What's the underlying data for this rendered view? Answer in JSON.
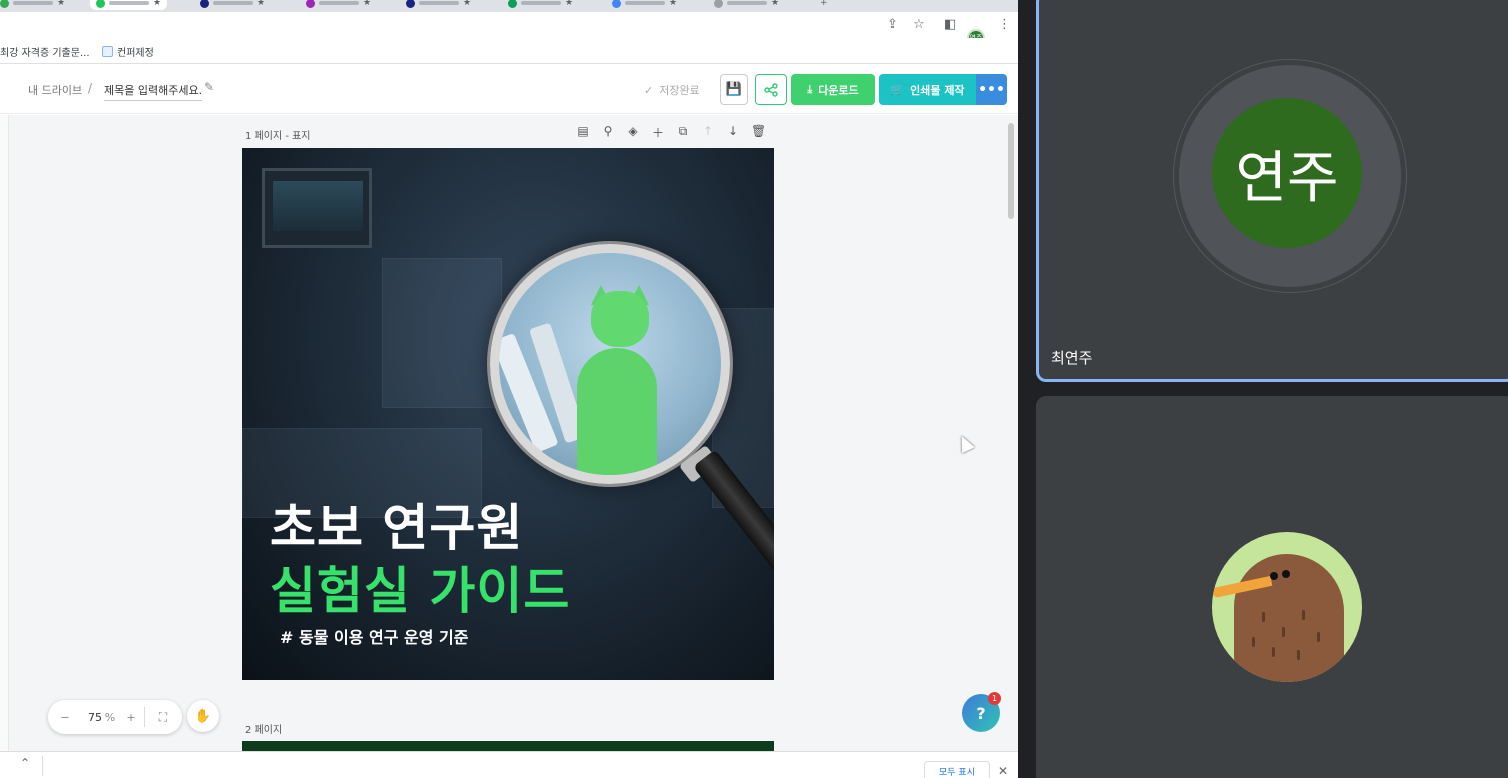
{
  "browser": {
    "tab_count": 8,
    "bookmarks": [
      {
        "label": "최강 자격증 기출문..."
      },
      {
        "label": "컨퍼제정"
      }
    ],
    "profile_initials": "연주"
  },
  "app": {
    "breadcrumb_root": "내 드라이브",
    "breadcrumb_sep": "/",
    "title_placeholder": "제목을 입력해주세요.",
    "save_status": "저장완료",
    "download_label": "다운로드",
    "print_label": "인쇄물 제작"
  },
  "editor": {
    "page1_label": "1 페이지 - 표지",
    "page2_label": "2 페이지",
    "cover": {
      "title_line1": "초보 연구원",
      "title_line2": "실험실 가이드",
      "subtitle": "# 동물 이용 연구 운영 기준"
    },
    "zoom": {
      "value": "75",
      "unit": "%"
    },
    "help_badge_count": "1"
  },
  "download_bar": {
    "show_all_label": "모두 표시"
  },
  "call": {
    "participant1": {
      "avatar_text": "연주",
      "name": "최연주",
      "avatar_color": "#2e6b1f"
    },
    "participant2": {
      "avatar": "kiwi-bird"
    }
  },
  "colors": {
    "accent_green": "#36e26a",
    "download_btn": "#3ed16e",
    "print_btn": "#1bc3c4",
    "more_btn": "#3a8dde",
    "active_tile_border": "#8ab4f8"
  }
}
